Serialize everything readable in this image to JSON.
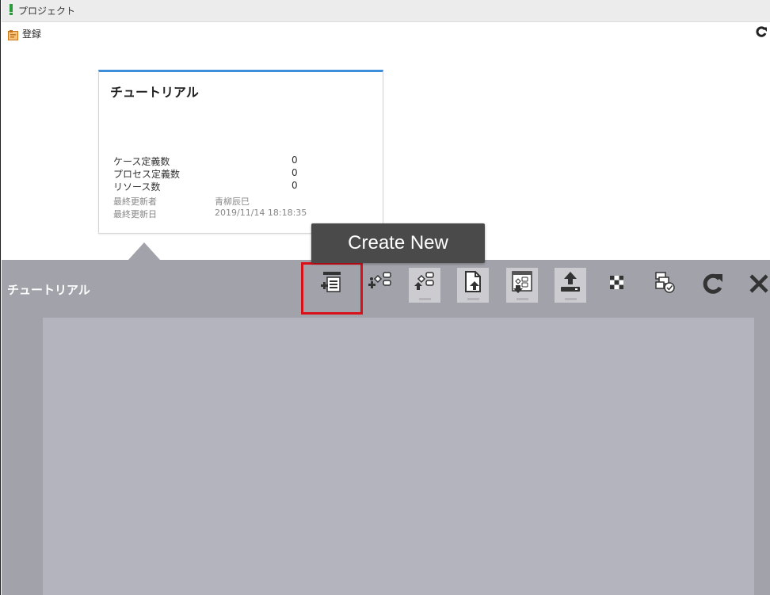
{
  "header": {
    "title": "プロジェクト"
  },
  "actions": {
    "register_label": "登録"
  },
  "project_card": {
    "title": "チュートリアル",
    "stats": [
      {
        "label": "ケース定義数",
        "value": "0"
      },
      {
        "label": "プロセス定義数",
        "value": "0"
      },
      {
        "label": "リソース数",
        "value": "0"
      }
    ],
    "meta": [
      {
        "label": "最終更新者",
        "value": "青柳辰巳"
      },
      {
        "label": "最終更新日",
        "value": "2019/11/14 18:18:35"
      }
    ]
  },
  "panel": {
    "title": "チュートリアル",
    "toolbar_icons": [
      "add-case-definition-icon",
      "add-process-icon",
      "import-process-icon",
      "import-file-icon",
      "export-process-icon",
      "upload-icon",
      "grid-icon",
      "validate-icon",
      "refresh-icon",
      "close-icon"
    ],
    "create_new_label": "Create New"
  },
  "colors": {
    "accent_blue": "#3f8edc",
    "panel_bg": "#a2a2ab",
    "canvas_bg": "#b4b4be",
    "highlight_red": "#d8101a",
    "button_dark": "#4a4a4a"
  }
}
